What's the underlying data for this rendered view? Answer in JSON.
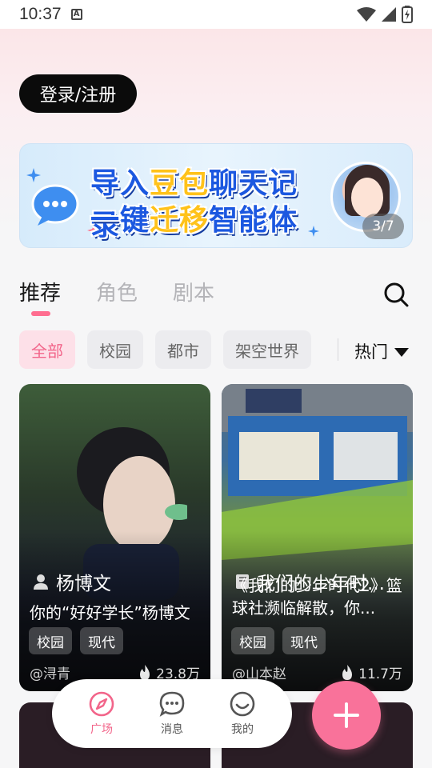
{
  "status_bar": {
    "time": "10:37",
    "notif_letter": "A"
  },
  "header": {
    "login_label": "登录/注册"
  },
  "banner": {
    "line1_a": "导入",
    "line1_hl": "豆包",
    "line1_b": "聊天记录",
    "line2_a": "一键",
    "line2_hl": "迁移",
    "line2_b": "智能体",
    "counter": "3/7"
  },
  "tabs": [
    {
      "label": "推荐",
      "active": true
    },
    {
      "label": "角色",
      "active": false
    },
    {
      "label": "剧本",
      "active": false
    }
  ],
  "filters": [
    {
      "label": "全部",
      "active": true
    },
    {
      "label": "校园",
      "active": false
    },
    {
      "label": "都市",
      "active": false
    },
    {
      "label": "架空世界",
      "active": false
    }
  ],
  "sort": {
    "label": "热门"
  },
  "cards": [
    {
      "name": "杨博文",
      "description": "你的“好好学长”杨博文",
      "tags": [
        "校园",
        "现代"
      ],
      "author": "@浔青",
      "likes": "23.8万"
    },
    {
      "name": "我们的少年时...",
      "description": "《我们的少年时代2》篮球社濒临解散，你...",
      "tags": [
        "校园",
        "现代"
      ],
      "author": "@山本赵",
      "likes": "11.7万"
    }
  ],
  "bottom_nav": [
    {
      "label": "广场",
      "icon": "compass-icon",
      "active": true
    },
    {
      "label": "消息",
      "icon": "chat-bubble-icon",
      "active": false
    },
    {
      "label": "我的",
      "icon": "smiley-icon",
      "active": false
    }
  ],
  "colors": {
    "accent": "#f9729a",
    "accent_text": "#f2658a",
    "banner_blue": "#1c58e0",
    "banner_yellow": "#ffc21a"
  }
}
